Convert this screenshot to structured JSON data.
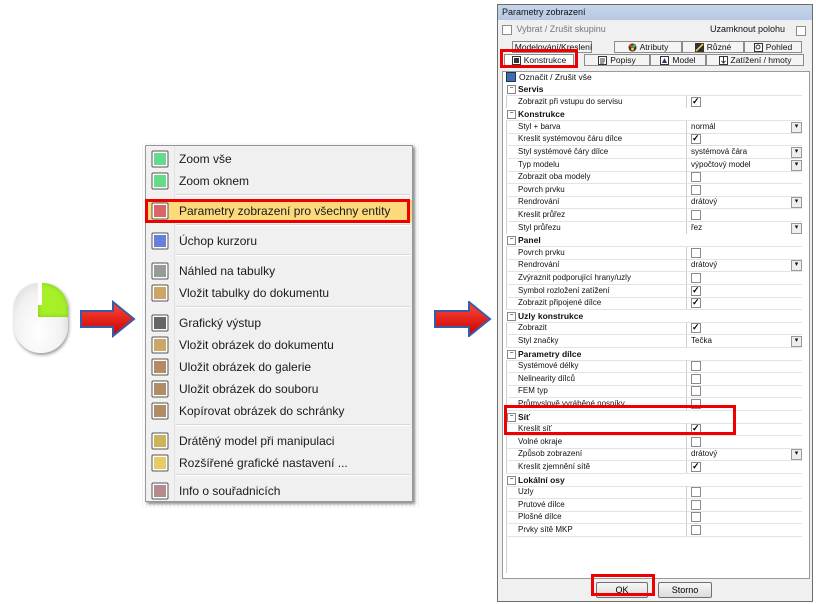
{
  "context_menu": {
    "items": [
      {
        "label": "Zoom vše",
        "icon": "zoom-all-icon"
      },
      {
        "label": "Zoom oknem",
        "icon": "zoom-window-icon"
      },
      {
        "label": "Parametry zobrazení pro všechny entity",
        "icon": "display-params-icon"
      },
      {
        "label": "Úchop kurzoru",
        "icon": "cursor-snap-icon"
      },
      {
        "label": "Náhled na tabulky",
        "icon": "table-preview-icon"
      },
      {
        "label": "Vložit tabulky do dokumentu",
        "icon": "insert-tables-icon"
      },
      {
        "label": "Grafický výstup",
        "icon": "graphic-output-icon"
      },
      {
        "label": "Vložit obrázek do dokumentu",
        "icon": "insert-picture-icon"
      },
      {
        "label": "Uložit obrázek do galerie",
        "icon": "save-gallery-icon"
      },
      {
        "label": "Uložit obrázek do souboru",
        "icon": "save-file-icon"
      },
      {
        "label": "Kopírovat obrázek do schránky",
        "icon": "copy-clipboard-icon"
      },
      {
        "label": "Drátěný model při manipulaci",
        "icon": "wireframe-icon"
      },
      {
        "label": "Rozšířené grafické nastavení ...",
        "icon": "advanced-graphics-icon"
      },
      {
        "label": "Info o souřadnicích",
        "icon": "coord-info-icon"
      }
    ]
  },
  "dialog": {
    "title": "Parametry zobrazení",
    "select_group": "Vybrat / Zrušit skupinu",
    "lock_position": "Uzamknout polohu",
    "tabs_row1": [
      "Modelování/Kreslení",
      "Atributy",
      "Různé",
      "Pohled"
    ],
    "tabs_row2": [
      "Konstrukce",
      "Popisy",
      "Model",
      "Zatížení / hmoty"
    ],
    "mark_all": "Označit / Zrušit vše",
    "rows": [
      {
        "type": "cat",
        "label": "Servis"
      },
      {
        "type": "cb",
        "label": "Zobrazit při vstupu do servisu",
        "checked": true
      },
      {
        "type": "cat",
        "label": "Konstrukce"
      },
      {
        "type": "dd",
        "label": "Styl + barva",
        "value": "normál"
      },
      {
        "type": "cb",
        "label": "Kreslit systémovou čáru dílce",
        "checked": true
      },
      {
        "type": "dd",
        "label": "Styl systémové čáry dílce",
        "value": "systémová čára"
      },
      {
        "type": "dd",
        "label": "Typ modelu",
        "value": "výpočtový model"
      },
      {
        "type": "cb",
        "label": "Zobrazit oba modely",
        "checked": false
      },
      {
        "type": "cb",
        "label": "Povrch prvku",
        "checked": false
      },
      {
        "type": "dd",
        "label": "Rendrování",
        "value": "drátový"
      },
      {
        "type": "cb",
        "label": "Kreslit průřez",
        "checked": false
      },
      {
        "type": "dd",
        "label": "Styl průřezu",
        "value": "řez"
      },
      {
        "type": "cat",
        "label": "Panel"
      },
      {
        "type": "cb",
        "label": "Povrch prvku",
        "checked": false
      },
      {
        "type": "dd",
        "label": "Rendrování",
        "value": "drátový"
      },
      {
        "type": "cb",
        "label": "Zvýraznit podporující hrany/uzly",
        "checked": false
      },
      {
        "type": "cb",
        "label": "Symbol rozložení zatížení",
        "checked": true
      },
      {
        "type": "cb",
        "label": "Zobrazit připojené dílce",
        "checked": true
      },
      {
        "type": "cat",
        "label": "Uzly konstrukce"
      },
      {
        "type": "cb",
        "label": "Zobrazit",
        "checked": true
      },
      {
        "type": "dd",
        "label": "Styl značky",
        "value": "Tečka"
      },
      {
        "type": "cat",
        "label": "Parametry dílce"
      },
      {
        "type": "cb",
        "label": "Systémové délky",
        "checked": false
      },
      {
        "type": "cb",
        "label": "Nelinearity dílců",
        "checked": false
      },
      {
        "type": "cb",
        "label": "FEM typ",
        "checked": false
      },
      {
        "type": "cb",
        "label": "Průmyslově vyráběné nosníky",
        "checked": false
      },
      {
        "type": "cat",
        "label": "Síť"
      },
      {
        "type": "cb",
        "label": "Kreslit síť",
        "checked": true
      },
      {
        "type": "cb",
        "label": "Volné okraje",
        "checked": false
      },
      {
        "type": "dd",
        "label": "Způsob zobrazení",
        "value": "drátový"
      },
      {
        "type": "cb",
        "label": "Kreslit zjemnění sítě",
        "checked": true
      },
      {
        "type": "cat",
        "label": "Lokální osy"
      },
      {
        "type": "cb",
        "label": "Uzly",
        "checked": false
      },
      {
        "type": "cb",
        "label": "Prutové dílce",
        "checked": false
      },
      {
        "type": "cb",
        "label": "Plošné dílce",
        "checked": false
      },
      {
        "type": "cb",
        "label": "Prvky sítě MKP",
        "checked": false
      }
    ],
    "ok_label": "OK",
    "cancel_label": "Storno"
  },
  "colors": {
    "highlight": "#e00000",
    "arrow": "#e01010",
    "menu_hover": "#fcd97a"
  }
}
